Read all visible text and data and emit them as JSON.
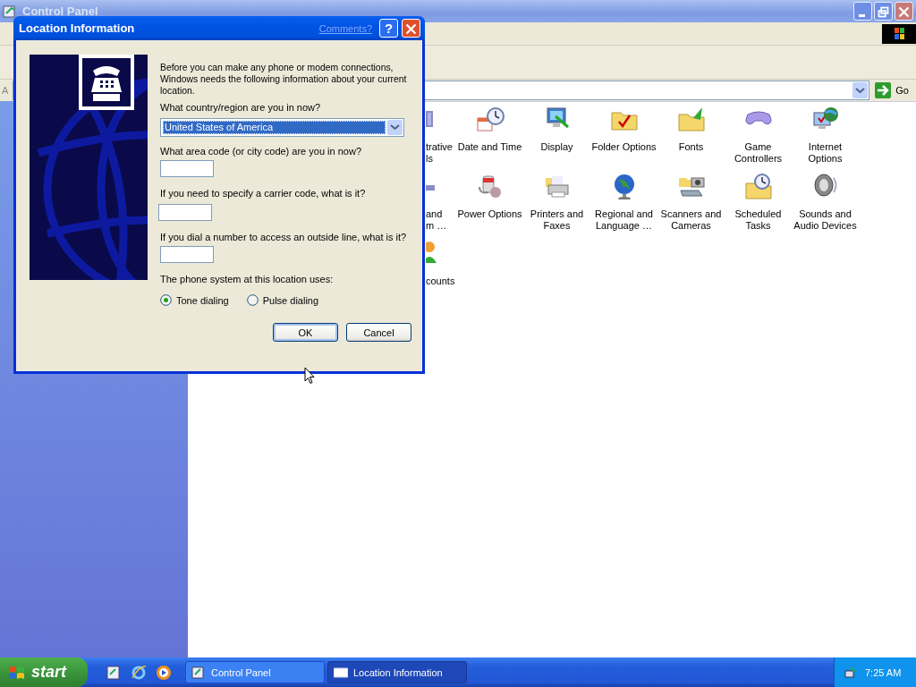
{
  "window": {
    "title": "Control Panel",
    "address_label": "A",
    "go_label": "Go"
  },
  "icon_rows": [
    {
      "items": [
        {
          "label": "trative\nls",
          "partial": true
        },
        {
          "label": "Date and Time",
          "partial": false
        },
        {
          "label": "Display",
          "partial": false
        },
        {
          "label": "Folder Options",
          "partial": false
        },
        {
          "label": "Fonts",
          "partial": false
        },
        {
          "label": "Game\nControllers",
          "partial": false
        },
        {
          "label": "Internet\nOptions",
          "partial": false
        }
      ]
    },
    {
      "items": [
        {
          "label": "and\nm …",
          "partial": true
        },
        {
          "label": "Power Options",
          "partial": false
        },
        {
          "label": "Printers and\nFaxes",
          "partial": false
        },
        {
          "label": "Regional and\nLanguage …",
          "partial": false
        },
        {
          "label": "Scanners and\nCameras",
          "partial": false
        },
        {
          "label": "Scheduled\nTasks",
          "partial": false
        },
        {
          "label": "Sounds and\nAudio Devices",
          "partial": false
        }
      ]
    },
    {
      "items": [
        {
          "label": "counts",
          "partial": true
        }
      ]
    }
  ],
  "dialog": {
    "title": "Location Information",
    "comments_link": "Comments?",
    "help": "?",
    "intro": "Before you can make any phone or modem connections, Windows needs the following information about your current location.",
    "country_label": "What country/region are you in now?",
    "country_value": "United States of America",
    "fields": [
      {
        "label": "What area code (or city code) are you in now?"
      },
      {
        "label": "If you need to specify a carrier code, what is it?"
      },
      {
        "label": "If you dial a number to access an outside line, what is it?"
      }
    ],
    "phone_system_label": "The phone system at this location uses:",
    "dialing": [
      {
        "label": "Tone dialing",
        "selected": true
      },
      {
        "label": "Pulse dialing",
        "selected": false
      }
    ],
    "buttons": [
      {
        "label": "OK",
        "default": true
      },
      {
        "label": "Cancel",
        "default": false
      }
    ]
  },
  "taskbar": {
    "start": "start",
    "tasks": [
      {
        "label": "Control Panel",
        "selected": false
      },
      {
        "label": "Location Information",
        "selected": true
      }
    ],
    "clock": "7:25 AM"
  }
}
